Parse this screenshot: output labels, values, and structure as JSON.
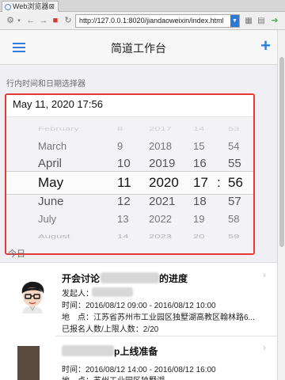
{
  "window": {
    "tab_title": "Web浏览器",
    "tab_close": "⊠",
    "url": "http://127.0.0.1:8020/jiandaoweixin/index.html"
  },
  "navbar": {
    "title": "简道工作台",
    "add_label": "+"
  },
  "picker_section": {
    "header": "行内时间和日期选择器",
    "value": "May 11, 2020 17:56",
    "rows": [
      {
        "month": "February",
        "day": "8",
        "year": "2017",
        "hour": "14",
        "colon": "",
        "minute": "53"
      },
      {
        "month": "March",
        "day": "9",
        "year": "2018",
        "hour": "15",
        "colon": "",
        "minute": "54"
      },
      {
        "month": "April",
        "day": "10",
        "year": "2019",
        "hour": "16",
        "colon": "",
        "minute": "55"
      },
      {
        "month": "May",
        "day": "11",
        "year": "2020",
        "hour": "17",
        "colon": ":",
        "minute": "56"
      },
      {
        "month": "June",
        "day": "12",
        "year": "2021",
        "hour": "18",
        "colon": "",
        "minute": "57"
      },
      {
        "month": "July",
        "day": "13",
        "year": "2022",
        "hour": "19",
        "colon": "",
        "minute": "58"
      },
      {
        "month": "August",
        "day": "14",
        "year": "2023",
        "hour": "20",
        "colon": "",
        "minute": "59"
      }
    ]
  },
  "today_section": {
    "header": "今日",
    "items": [
      {
        "title_suffix": "开会讨论",
        "title_end": "的进度",
        "initiator_label": "发起人：",
        "time": "时间：2016/08/12 09:00 - 2016/08/12 10:00",
        "location": "地　点：江苏省苏州市工业园区独墅湖高教区翰林路6...",
        "registered": "已报名人数/上限人数：2/20"
      },
      {
        "title_end": "p上线准备",
        "time": "时间：2016/08/12 14:00 - 2016/08/12 16:00",
        "location": "地　点：苏州工业园区独墅湖..."
      }
    ]
  },
  "colors": {
    "accent": "#2f7fd8",
    "highlight_border": "#e53935"
  }
}
